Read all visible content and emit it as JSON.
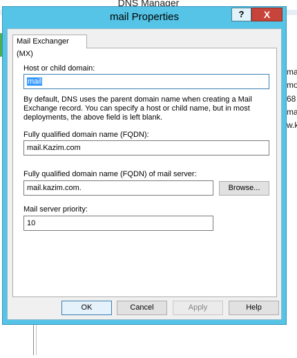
{
  "background_app": {
    "title": "DNS Manager",
    "side_fragments": [
      "ma",
      "mo",
      "68",
      "ma",
      "w.ka"
    ]
  },
  "dialog": {
    "title": "mail Properties",
    "help_label": "?",
    "close_label": "X",
    "tabs": [
      {
        "label": "Mail Exchanger (MX)",
        "active": true
      }
    ],
    "host_label": "Host or child domain:",
    "host_value": "mail",
    "description": "By default, DNS uses the parent domain name when creating a Mail Exchange record. You can specify a host or child name, but in most deployments, the above field is left blank.",
    "fqdn_label": "Fully qualified domain name (FQDN):",
    "fqdn_value": "mail.Kazim.com",
    "mail_server_label": "Fully qualified domain name (FQDN) of mail server:",
    "mail_server_value": "mail.kazim.com.",
    "browse_label": "Browse...",
    "priority_label": "Mail server priority:",
    "priority_value": "10",
    "buttons": {
      "ok": "OK",
      "cancel": "Cancel",
      "apply": "Apply",
      "help": "Help"
    }
  },
  "colors": {
    "titlebar": "#55c4e6",
    "close": "#c7443a",
    "selection": "#3399ff"
  }
}
